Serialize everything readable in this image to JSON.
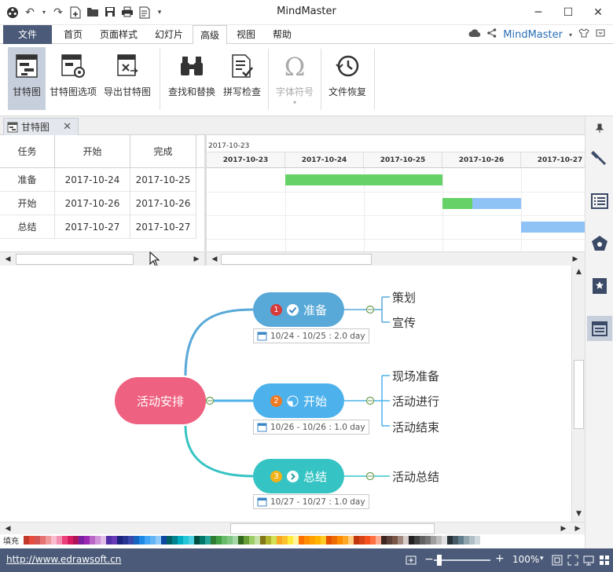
{
  "window": {
    "title": "MindMaster",
    "controls": [
      "minimize",
      "maximize",
      "close"
    ]
  },
  "quick_access": [
    "app-logo-icon",
    "undo-icon",
    "redo-icon",
    "new-icon",
    "open-icon",
    "save-icon",
    "print-icon",
    "export-icon",
    "more-icon"
  ],
  "menu": {
    "tabs": [
      "文件",
      "首页",
      "页面样式",
      "幻灯片",
      "高级",
      "视图",
      "帮助"
    ],
    "active_tab": "高级",
    "brand": "MindMaster"
  },
  "ribbon": {
    "buttons": [
      {
        "label": "甘特图",
        "icon": "gantt-icon",
        "selected": true
      },
      {
        "label": "甘特图选项",
        "icon": "gantt-options-icon"
      },
      {
        "label": "导出甘特图",
        "icon": "export-gantt-icon"
      },
      {
        "label": "查找和替换",
        "icon": "binoculars-icon"
      },
      {
        "label": "拼写检查",
        "icon": "spellcheck-icon"
      },
      {
        "label": "字体符号",
        "icon": "omega-icon",
        "disabled": true
      },
      {
        "label": "文件恢复",
        "icon": "history-icon"
      }
    ]
  },
  "doc_tab": {
    "label": "甘特图"
  },
  "gantt": {
    "columns": [
      "任务",
      "开始",
      "完成"
    ],
    "rows": [
      {
        "task": "准备",
        "start": "2017-10-24",
        "end": "2017-10-25"
      },
      {
        "task": "开始",
        "start": "2017-10-26",
        "end": "2017-10-26"
      },
      {
        "task": "总结",
        "start": "2017-10-27",
        "end": "2017-10-27"
      }
    ],
    "top_date": "2017-10-23",
    "days": [
      "2017-10-23",
      "2017-10-24",
      "2017-10-25",
      "2017-10-26",
      "2017-10-27"
    ],
    "colors": {
      "done": "#66d166",
      "remaining": "#8fc2f5"
    }
  },
  "mindmap": {
    "central": {
      "label": "活动安排",
      "color": "#ee6180"
    },
    "branches": [
      {
        "label": "准备",
        "number": "1",
        "date": "10/24 - 10/25 : 2.0 day",
        "color": "#58a9d8",
        "badge_color": "#d83a3a",
        "children": [
          "策划",
          "宣传"
        ]
      },
      {
        "label": "开始",
        "number": "2",
        "date": "10/26 - 10/26 : 1.0 day",
        "color": "#4db2ec",
        "badge_color": "#f07a22",
        "children": [
          "现场准备",
          "活动进行",
          "活动结束"
        ]
      },
      {
        "label": "总结",
        "number": "3",
        "date": "10/27 - 10/27 : 1.0 day",
        "color": "#36c3c3",
        "badge_color": "#f2b218",
        "children": [
          "活动总结"
        ]
      }
    ]
  },
  "palette": {
    "label": "填充",
    "colors": [
      "#c0392b",
      "#e74c3c",
      "#d35454",
      "#e57373",
      "#ef9a9a",
      "#f8bbd0",
      "#f48fb1",
      "#ec407a",
      "#d81b60",
      "#ad1457",
      "#7b1fa2",
      "#9c27b0",
      "#ba68c8",
      "#ce93d8",
      "#e1bee7",
      "#512da8",
      "#673ab7",
      "#1a237e",
      "#283593",
      "#3949ab",
      "#1565c0",
      "#1e88e5",
      "#42a5f5",
      "#64b5f6",
      "#90caf9",
      "#0d47a1",
      "#006064",
      "#00838f",
      "#00acc1",
      "#26c6da",
      "#4dd0e1",
      "#004d40",
      "#00796b",
      "#26a69a",
      "#2e7d32",
      "#43a047",
      "#66bb6a",
      "#81c784",
      "#a5d6a7",
      "#33691e",
      "#689f38",
      "#9ccc65",
      "#c5e1a5",
      "#827717",
      "#afb42b",
      "#d4e157",
      "#f9a825",
      "#fbc02d",
      "#ffeb3b",
      "#fff59d",
      "#ff6f00",
      "#ff8f00",
      "#ffa000",
      "#ffb300",
      "#ffca28",
      "#e65100",
      "#ef6c00",
      "#fb8c00",
      "#ffa726",
      "#ffcc80",
      "#bf360c",
      "#d84315",
      "#f4511e",
      "#ff7043",
      "#ffab91",
      "#3e2723",
      "#5d4037",
      "#795548",
      "#a1887f",
      "#d7ccc8",
      "#212121",
      "#424242",
      "#616161",
      "#757575",
      "#9e9e9e",
      "#bdbdbd",
      "#e0e0e0",
      "#263238",
      "#455a64",
      "#607d8b",
      "#90a4ae",
      "#b0bec5",
      "#cfd8dc",
      "#ffffff"
    ]
  },
  "status": {
    "url": "http://www.edrawsoft.cn",
    "zoom": "100%"
  }
}
